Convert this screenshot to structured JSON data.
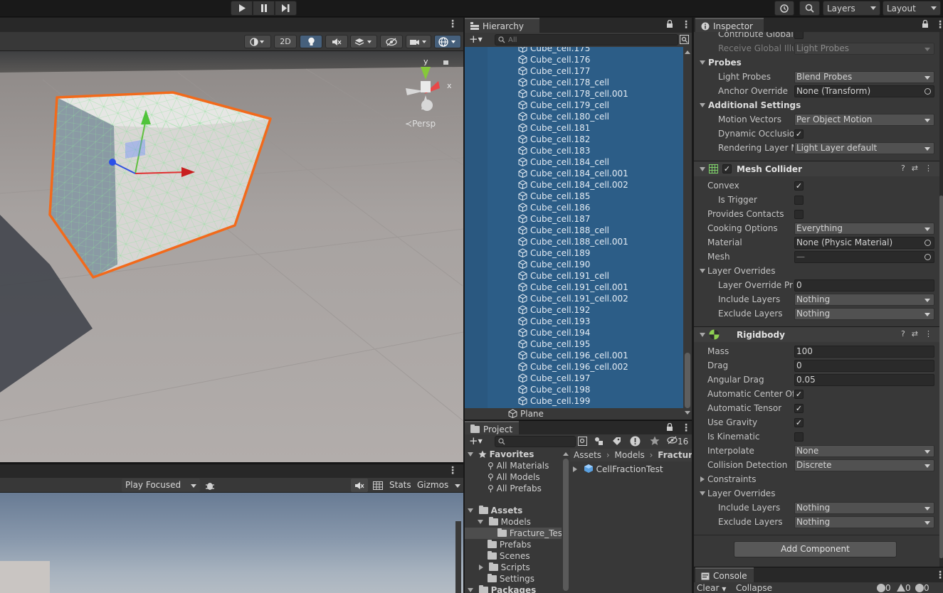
{
  "toolbar": {
    "layers_label": "Layers",
    "layout_label": "Layout"
  },
  "scene": {
    "mode_2d": "2D",
    "persp_label": "Persp",
    "gizmo_axis_y": "y",
    "gizmo_axis_x": "x"
  },
  "game": {
    "play_focused": "Play Focused",
    "stats": "Stats",
    "gizmos": "Gizmos"
  },
  "hierarchy": {
    "tab": "Hierarchy",
    "search_placeholder": "All",
    "items": [
      "Cube_cell.175",
      "Cube_cell.176",
      "Cube_cell.177",
      "Cube_cell.178_cell",
      "Cube_cell.178_cell.001",
      "Cube_cell.179_cell",
      "Cube_cell.180_cell",
      "Cube_cell.181",
      "Cube_cell.182",
      "Cube_cell.183",
      "Cube_cell.184_cell",
      "Cube_cell.184_cell.001",
      "Cube_cell.184_cell.002",
      "Cube_cell.185",
      "Cube_cell.186",
      "Cube_cell.187",
      "Cube_cell.188_cell",
      "Cube_cell.188_cell.001",
      "Cube_cell.189",
      "Cube_cell.190",
      "Cube_cell.191_cell",
      "Cube_cell.191_cell.001",
      "Cube_cell.191_cell.002",
      "Cube_cell.192",
      "Cube_cell.193",
      "Cube_cell.194",
      "Cube_cell.195",
      "Cube_cell.196_cell.001",
      "Cube_cell.196_cell.002",
      "Cube_cell.197",
      "Cube_cell.198",
      "Cube_cell.199"
    ],
    "plane": "Plane"
  },
  "project": {
    "tab": "Project",
    "hidden_count": "16",
    "favorites": "Favorites",
    "favorite_items": [
      "All Materials",
      "All Models",
      "All Prefabs"
    ],
    "assets": "Assets",
    "models": "Models",
    "fracture": "Fracture_Tes",
    "folders": [
      "Prefabs",
      "Scenes",
      "Scripts",
      "Settings"
    ],
    "packages": "Packages",
    "breadcrumb": [
      "Assets",
      "Models",
      "Fracture_"
    ],
    "content_item": "CellFractionTest"
  },
  "inspector": {
    "tab": "Inspector",
    "contribute_gi": "Contribute Global I",
    "receive_gi": "Receive Global Illu",
    "receive_gi_value": "Light Probes",
    "probes": "Probes",
    "light_probes": "Light Probes",
    "light_probes_value": "Blend Probes",
    "anchor_override": "Anchor Override",
    "anchor_override_value": "None (Transform)",
    "additional_settings": "Additional Settings",
    "motion_vectors": "Motion Vectors",
    "motion_vectors_value": "Per Object Motion",
    "dynamic_occlusion": "Dynamic Occlusion",
    "rendering_layer": "Rendering Layer M",
    "rendering_layer_value": "Light Layer default",
    "mesh_collider": {
      "title": "Mesh Collider",
      "convex": "Convex",
      "is_trigger": "Is Trigger",
      "provides_contacts": "Provides Contacts",
      "cooking_options": "Cooking Options",
      "cooking_options_value": "Everything",
      "material": "Material",
      "material_value": "None (Physic Material)",
      "mesh": "Mesh",
      "mesh_value": "—",
      "layer_overrides": "Layer Overrides",
      "layer_override_priority": "Layer Override Prio",
      "layer_override_priority_value": "0",
      "include_layers": "Include Layers",
      "include_layers_value": "Nothing",
      "exclude_layers": "Exclude Layers",
      "exclude_layers_value": "Nothing"
    },
    "rigidbody": {
      "title": "Rigidbody",
      "mass": "Mass",
      "mass_value": "100",
      "drag": "Drag",
      "drag_value": "0",
      "angular_drag": "Angular Drag",
      "angular_drag_value": "0.05",
      "auto_center": "Automatic Center Of I",
      "auto_tensor": "Automatic Tensor",
      "use_gravity": "Use Gravity",
      "is_kinematic": "Is Kinematic",
      "interpolate": "Interpolate",
      "interpolate_value": "None",
      "collision_detection": "Collision Detection",
      "collision_detection_value": "Discrete",
      "constraints": "Constraints",
      "layer_overrides": "Layer Overrides",
      "include_layers": "Include Layers",
      "include_layers_value": "Nothing",
      "exclude_layers": "Exclude Layers",
      "exclude_layers_value": "Nothing"
    },
    "add_component": "Add Component"
  },
  "console": {
    "tab": "Console",
    "clear": "Clear",
    "collapse": "Collapse",
    "log_count": "0",
    "warn_count": "0",
    "error_count": "0"
  },
  "colors": {
    "selection_blue": "#2c5d87",
    "panel_bg": "#383838",
    "outline_orange": "#f26a1b"
  }
}
